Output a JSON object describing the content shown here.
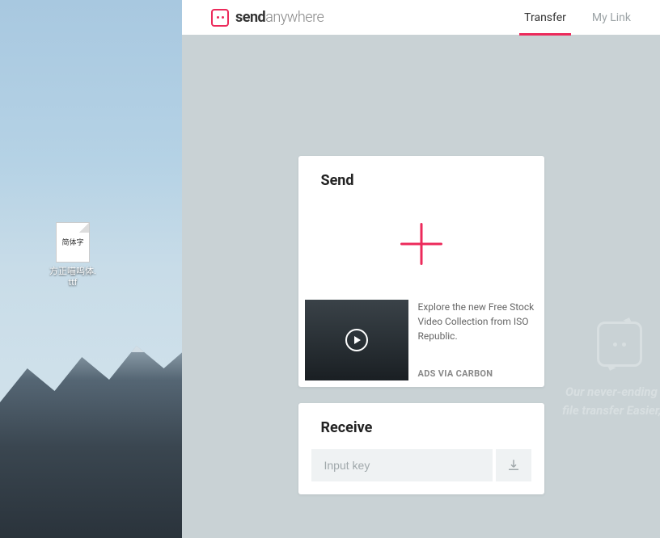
{
  "desktop": {
    "file_icon_text": "简体字",
    "file_label_1": "方正喵呜体.",
    "file_label_2": "ttf"
  },
  "header": {
    "logo_bold": "send",
    "logo_light": "anywhere",
    "tabs": {
      "transfer": "Transfer",
      "mylink": "My Link"
    }
  },
  "send": {
    "title": "Send"
  },
  "ad": {
    "description": "Explore the new Free Stock Video Collection from ISO Republic.",
    "via": "ADS VIA CARBON"
  },
  "receive": {
    "title": "Receive",
    "placeholder": "Input key"
  },
  "promo": {
    "line1": "Our never-ending go",
    "line2": "file transfer Easier, Fa"
  }
}
